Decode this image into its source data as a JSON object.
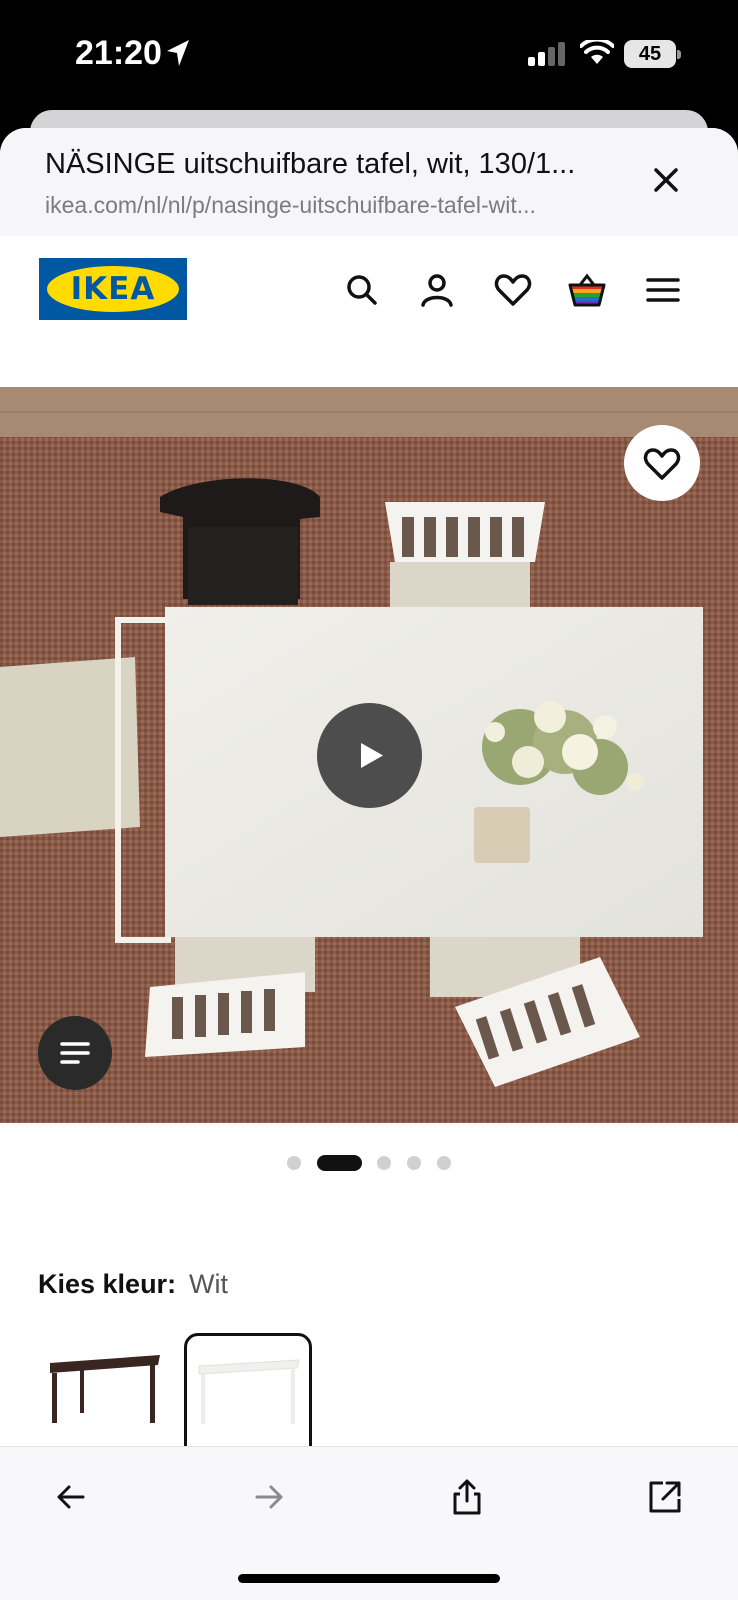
{
  "status_bar": {
    "time": "21:20",
    "battery": "45"
  },
  "browser": {
    "page_title": "NÄSINGE uitschuifbare tafel, wit, 130/1...",
    "url": "ikea.com/nl/nl/p/nasinge-uitschuifbare-tafel-wit..."
  },
  "header": {
    "logo_text": "IKEA",
    "icons": [
      "search-icon",
      "account-icon",
      "heart-icon",
      "shopping-bag-icon",
      "hamburger-menu-icon"
    ]
  },
  "media": {
    "slide_count": 5,
    "active_slide": 2
  },
  "color_picker": {
    "label": "Kies kleur:",
    "selected": "Wit",
    "options": [
      "dark-brown-table",
      "white-table"
    ]
  },
  "colors": {
    "ikea_blue": "#0058a3",
    "ikea_yellow": "#ffdb00"
  }
}
